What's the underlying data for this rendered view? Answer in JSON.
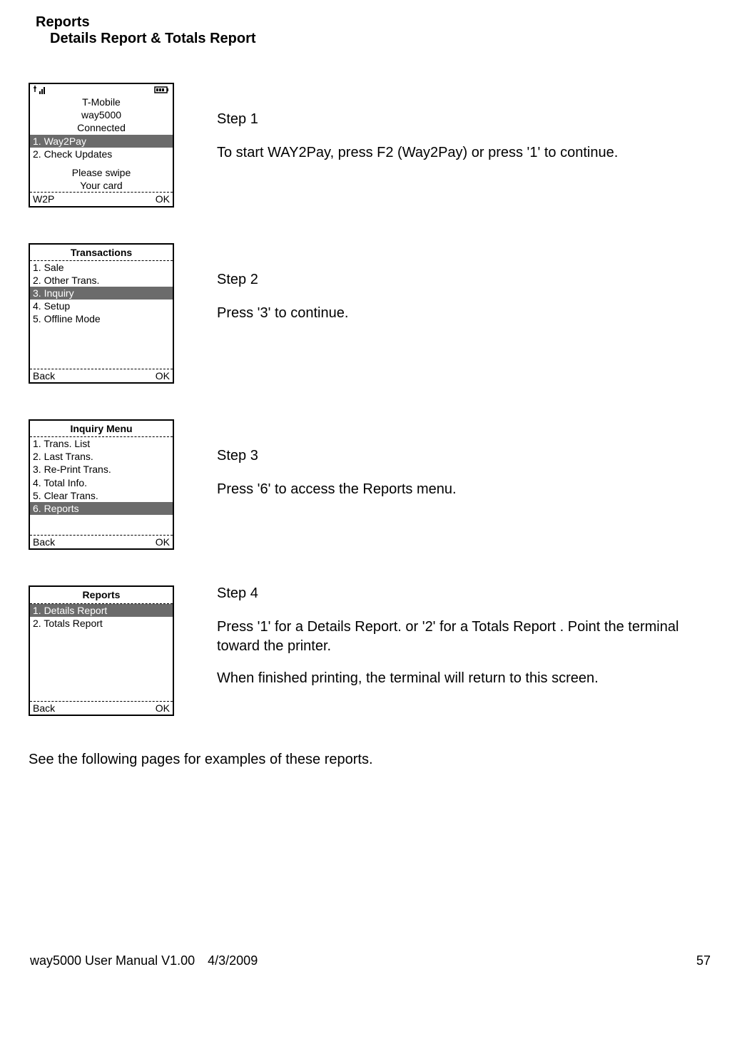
{
  "header": {
    "title1": "Reports",
    "title2": "Details Report & Totals Report"
  },
  "step1": {
    "label": "Step 1",
    "body": "To start WAY2Pay, press F2 (Way2Pay) or press '1' to continue.",
    "carrier": "T-Mobile",
    "device": "way5000",
    "status": "Connected",
    "menu1": "1. Way2Pay",
    "menu2": "2. Check Updates",
    "prompt1": "Please swipe",
    "prompt2": "Your card",
    "footL": "W2P",
    "footR": "OK"
  },
  "step2": {
    "label": "Step 2",
    "body": "Press '3' to continue.",
    "title": "Transactions",
    "m1": "1. Sale",
    "m2": "2. Other Trans.",
    "m3": "3. Inquiry",
    "m4": "4. Setup",
    "m5": "5. Offline Mode",
    "footL": "Back",
    "footR": "OK"
  },
  "step3": {
    "label": "Step 3",
    "body": "Press '6' to access the Reports menu.",
    "title": "Inquiry Menu",
    "m1": "1. Trans. List",
    "m2": "2. Last Trans.",
    "m3": "3. Re-Print Trans.",
    "m4": "4. Total Info.",
    "m5": "5. Clear Trans.",
    "m6": "6. Reports",
    "footL": "Back",
    "footR": "OK"
  },
  "step4": {
    "label": "Step 4",
    "body1": "Press '1' for a Details Report. or '2' for a Totals Report . Point the terminal toward the printer.",
    "body2": "When finished printing, the terminal will return to this screen.",
    "title": "Reports",
    "m1": "1. Details Report",
    "m2": "2. Totals Report",
    "footL": "Back",
    "footR": "OK"
  },
  "midnote": "See the following pages for examples of these reports.",
  "footer": {
    "manual": "way5000 User Manual V1.00",
    "date": "4/3/2009",
    "page": "57"
  }
}
